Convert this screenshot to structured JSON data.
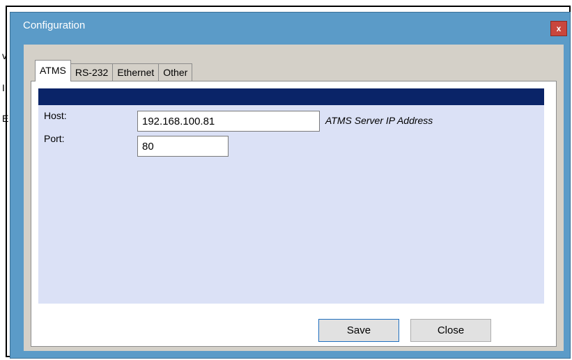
{
  "background_glyphs": [
    "v",
    "I",
    "E"
  ],
  "window": {
    "title": "Configuration",
    "close_label": "x"
  },
  "tabs": [
    {
      "label": "ATMS",
      "active": true
    },
    {
      "label": "RS-232",
      "active": false
    },
    {
      "label": "Ethernet",
      "active": false
    },
    {
      "label": "Other",
      "active": false
    }
  ],
  "atms": {
    "host_label": "Host:",
    "host_value": "192.168.100.81",
    "host_hint": "ATMS Server IP Address",
    "port_label": "Port:",
    "port_value": "80"
  },
  "buttons": {
    "save": "Save",
    "close": "Close"
  },
  "colors": {
    "titlebar": "#5b9bc8",
    "panel_header": "#0a2468",
    "panel_bg": "#dbe1f6",
    "client_bg": "#d4d0c8",
    "close_button": "#c9463d"
  }
}
